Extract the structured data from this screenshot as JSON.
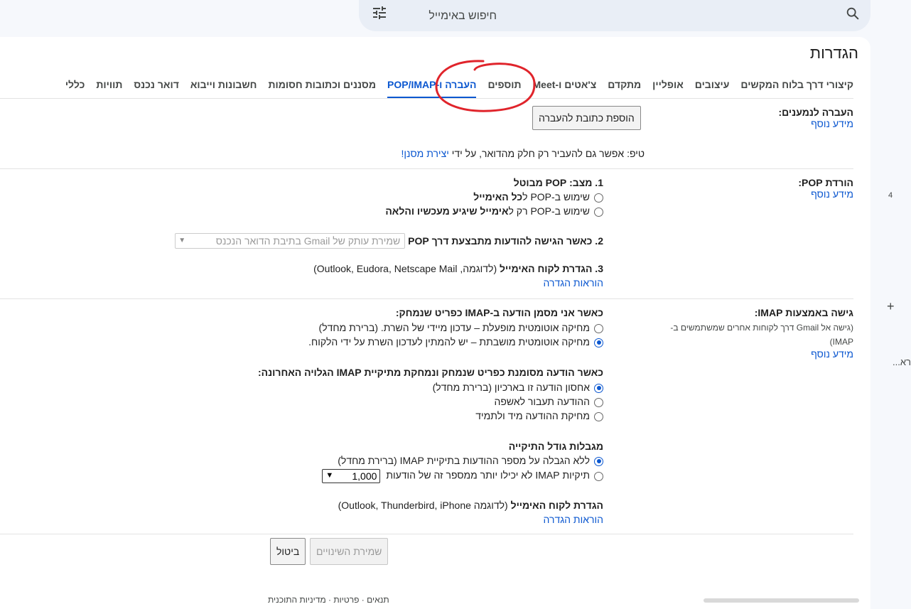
{
  "search": {
    "placeholder": "חיפוש באימייל",
    "search_icon": "search-icon",
    "filter_icon": "tune-icon"
  },
  "page_title": "הגדרות",
  "tabs": [
    {
      "label": "כללי",
      "active": false
    },
    {
      "label": "תוויות",
      "active": false
    },
    {
      "label": "דואר נכנס",
      "active": false
    },
    {
      "label": "חשבונות וייבוא",
      "active": false
    },
    {
      "label": "מסננים וכתובות חסומות",
      "active": false
    },
    {
      "label": "העברה ו-POP/IMAP",
      "active": true
    },
    {
      "label": "תוספים",
      "active": false
    },
    {
      "label": "צ'אטים ו-Meet",
      "active": false
    },
    {
      "label": "מתקדם",
      "active": false
    },
    {
      "label": "אופליין",
      "active": false
    },
    {
      "label": "עיצובים",
      "active": false
    },
    {
      "label": "קיצורי דרך בלוח המקשים",
      "active": false
    }
  ],
  "forwarding": {
    "label": "העברה לנמענים:",
    "learn_more": "מידע נוסף",
    "add_button": "הוספת כתובת להעברה",
    "tip_prefix": "טיפ: אפשר גם להעביר רק חלק מהדואר, על ידי ",
    "tip_link": "יצירת מסנן!"
  },
  "pop": {
    "label": "הורדת POP:",
    "learn_more": "מידע נוסף",
    "status": "1. מצב: POP מבוטל",
    "opt1_prefix": "שימוש ב-POP ל",
    "opt1_bold": "כל האימייל",
    "opt2_prefix": "שימוש ב-POP רק ל",
    "opt2_bold": "אימייל שיגיע מעכשיו והלאה",
    "step2_label": "2. כאשר הגישה להודעות מתבצעת דרך POP",
    "step2_select": "שמירת עותק של Gmail בתיבת הדואר הנכנס",
    "step3_label": "3. הגדרת לקוח האימייל",
    "step3_examples": "(לדוגמה, Outlook, Eudora, Netscape Mail)",
    "setup_link": "הוראות הגדרה"
  },
  "imap": {
    "label": "גישה באמצעות IMAP:",
    "sub1": "(גישה אל Gmail דרך לקוחות אחרים שמשתמשים ב-",
    "sub2": "IMAP)",
    "learn_more": "מידע נוסף",
    "deleted_heading": "כאשר אני מסמן הודעה ב-IMAP כפריט שנמחק:",
    "autoexpunge_on": "מחיקה אוטומטית מופעלת – עדכון מיידי של השרת. (ברירת מחדל)",
    "autoexpunge_off": "מחיקה אוטומטית מושבתת – יש להמתין לעדכון השרת על ידי הלקוח.",
    "expunge_heading": "כאשר הודעה מסומנת כפריט שנמחק ונמחקת מתיקיית IMAP הגלויה האחרונה:",
    "archive": "אחסון הודעה זו בארכיון (ברירת מחדל)",
    "trash": "ההודעה תעבור לאשפה",
    "delete_forever": "מחיקת ההודעה מיד ולתמיד",
    "folder_heading": "מגבלות גודל התיקייה",
    "no_limit": "ללא הגבלה על מספר ההודעות בתיקיית IMAP (ברירת מחדל)",
    "limit": "תיקיות IMAP לא יכילו יותר ממספר זה של הודעות",
    "limit_value": "1,000",
    "client_heading": "הגדרת לקוח האימייל",
    "client_examples": "(לדוגמה Outlook, Thunderbird, iPhone)",
    "setup_link": "הוראות הגדרה"
  },
  "actions": {
    "save": "שמירת השינויים",
    "cancel": "ביטול"
  },
  "footer": {
    "terms": "תנאים",
    "privacy": "פרטיות",
    "policy": "מדיניות התוכנית"
  },
  "right_strip": {
    "number": "4",
    "plus": "+",
    "truncated": "רא..."
  },
  "colors": {
    "accent": "#0b57d0",
    "annotation": "#e0242b"
  }
}
